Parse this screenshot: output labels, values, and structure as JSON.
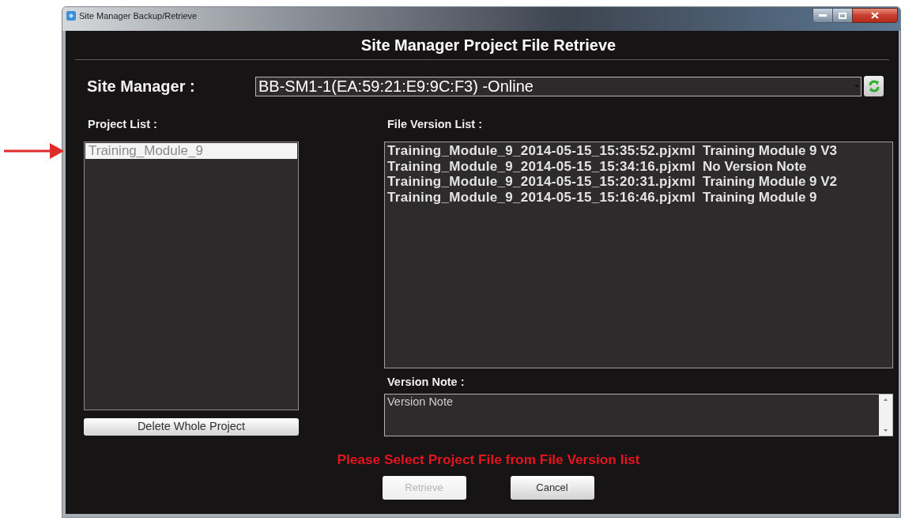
{
  "window": {
    "title": "Site Manager Backup/Retrieve"
  },
  "heading": "Site Manager Project File Retrieve",
  "site_manager": {
    "label": "Site Manager :",
    "value": "BB-SM1-1(EA:59:21:E9:9C:F3) -Online"
  },
  "project_list": {
    "label": "Project List :",
    "items": [
      {
        "name": "Training_Module_9",
        "selected": true
      }
    ],
    "delete_button": "Delete Whole Project"
  },
  "file_version_list": {
    "label": "File Version List :",
    "rows": [
      {
        "file": "Training_Module_9_2014-05-15_15:35:52.pjxml",
        "note": "Training Module 9 V3",
        "selected": false
      },
      {
        "file": "Training_Module_9_2014-05-15_15:34:16.pjxml",
        "note": "No Version Note",
        "selected": false
      },
      {
        "file": "Training_Module_9_2014-05-15_15:20:31.pjxml",
        "note": "Training Module 9 V2",
        "selected": false
      },
      {
        "file": "Training_Module_9_2014-05-15_15:16:46.pjxml",
        "note": "Training Module 9",
        "selected": false
      }
    ]
  },
  "version_note": {
    "label": "Version Note :",
    "placeholder": "Version Note"
  },
  "message": "Please Select Project File from File Version list",
  "buttons": [
    {
      "label": "Retrieve",
      "disabled": true
    },
    {
      "label": "Cancel",
      "disabled": false
    }
  ]
}
